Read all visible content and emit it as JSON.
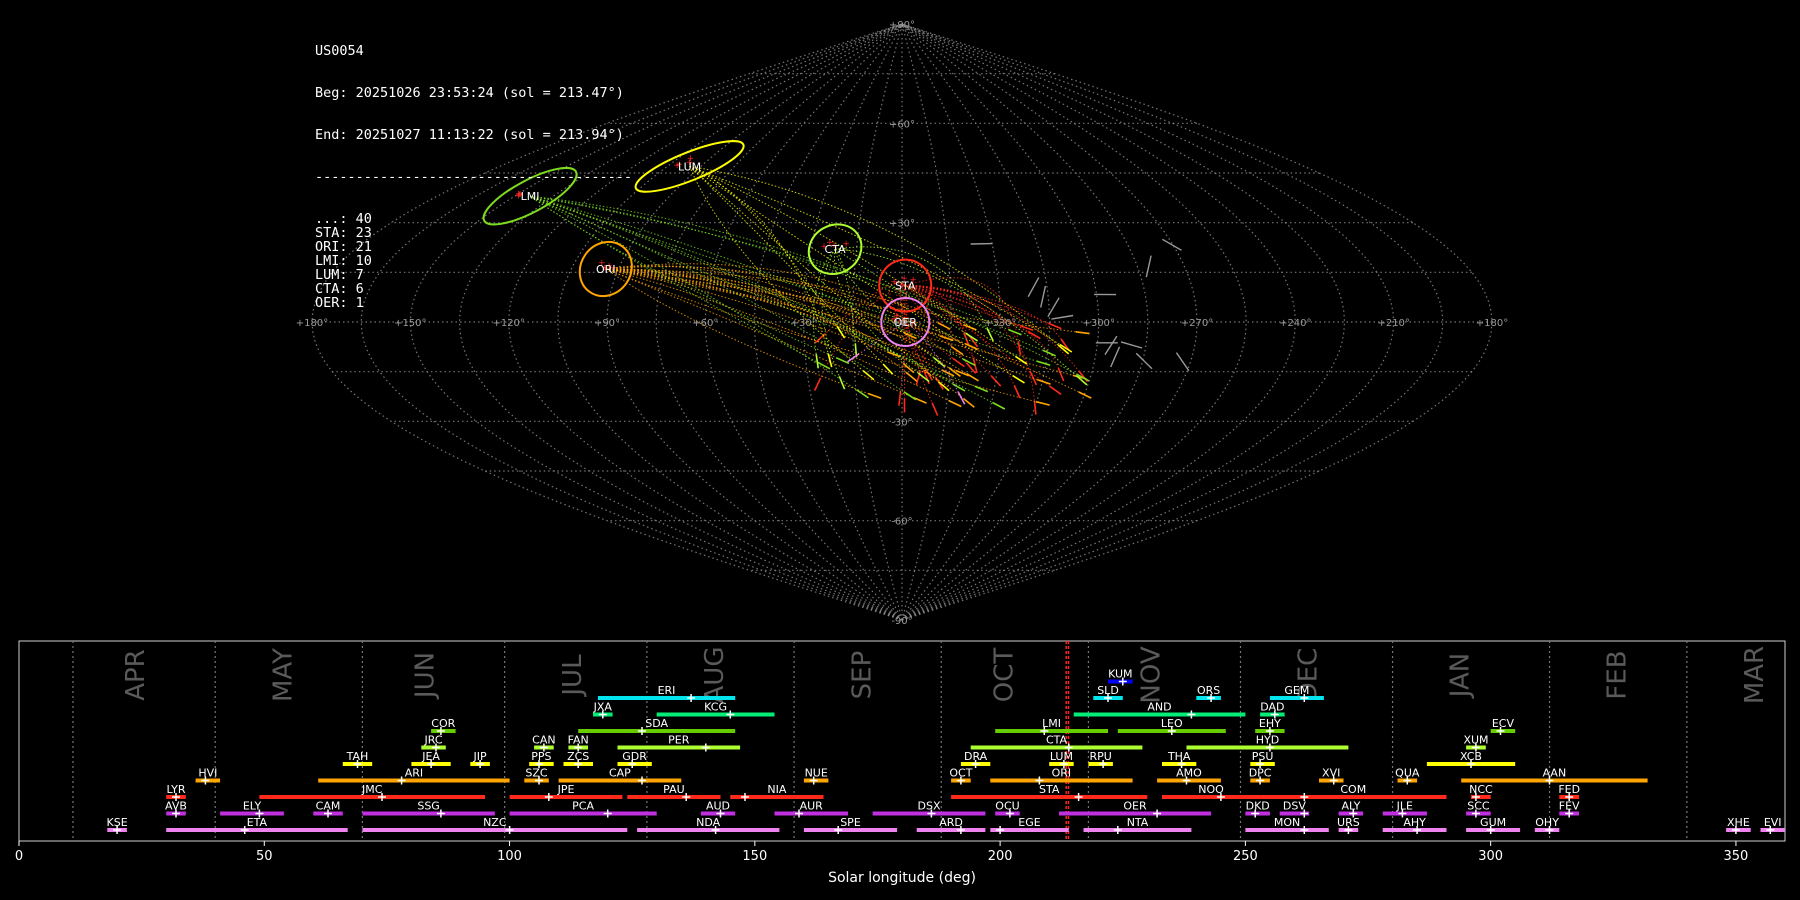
{
  "info": {
    "station": "US0054",
    "beg": "Beg: 20251026 23:53:24 (sol = 213.47°)",
    "end": "End: 20251027 11:13:22 (sol = 213.94°)",
    "separator": "---------------------------------------",
    "counts": [
      {
        "code": "...",
        "count": 40
      },
      {
        "code": "STA",
        "count": 23
      },
      {
        "code": "ORI",
        "count": 21
      },
      {
        "code": "LMI",
        "count": 10
      },
      {
        "code": "LUM",
        "count": 7
      },
      {
        "code": "CTA",
        "count": 6
      },
      {
        "code": "OER",
        "count": 1
      }
    ]
  },
  "chart_data": [
    {
      "type": "scatter",
      "projection": "sinusoidal sky map",
      "lon_tick_labels": [
        "+180°",
        "+150°",
        "+120°",
        "+90°",
        "+60°",
        "+30°",
        "+0°",
        "+330°",
        "+300°",
        "+270°",
        "+240°",
        "+210°",
        "+180°"
      ],
      "lat_tick_labels": [
        "+90°",
        "+60°",
        "+30°",
        "-30°",
        "-60°",
        "-90°"
      ],
      "colors": {
        "sporadic": "#ffffff",
        "STA": "#ff2a1a",
        "ORI": "#ffa500",
        "LMI": "#7ddc1f",
        "LUM": "#ffff00",
        "CTA": "#adff2f",
        "OER": "#ee82ee",
        "grid": "#8a8a8a"
      },
      "radiants": [
        {
          "code": "LUM",
          "lon": 95,
          "lat": 47,
          "color": "#ffff00"
        },
        {
          "code": "LMI",
          "lon": 144,
          "lat": 38,
          "color": "#7ddc1f"
        },
        {
          "code": "CTA",
          "lon": 22,
          "lat": 22,
          "color": "#adff2f"
        },
        {
          "code": "ORI",
          "lon": 94,
          "lat": 16,
          "color": "#ffa500"
        },
        {
          "code": "STA",
          "lon": -1,
          "lat": 11,
          "color": "#ff2a1a"
        },
        {
          "code": "OER",
          "lon": -1,
          "lat": 0,
          "color": "#ee82ee"
        }
      ]
    },
    {
      "type": "timeline",
      "xlabel": "Solar longitude (deg)",
      "xlim": [
        0,
        360
      ],
      "xticks": [
        0,
        50,
        100,
        150,
        200,
        250,
        300,
        350
      ],
      "current_sol": [
        213.47,
        213.94
      ],
      "months": [
        {
          "label": "APR",
          "pos": 24,
          "line": 11
        },
        {
          "label": "MAY",
          "pos": 54,
          "line": 40
        },
        {
          "label": "JUN",
          "pos": 83,
          "line": 70
        },
        {
          "label": "JUL",
          "pos": 113,
          "line": 99
        },
        {
          "label": "AUG",
          "pos": 142,
          "line": 128
        },
        {
          "label": "SEP",
          "pos": 172,
          "line": 158
        },
        {
          "label": "OCT",
          "pos": 201,
          "line": 188
        },
        {
          "label": "NOV",
          "pos": 231,
          "line": 218
        },
        {
          "label": "DEC",
          "pos": 263,
          "line": 249
        },
        {
          "label": "JAN",
          "pos": 294,
          "line": 280
        },
        {
          "label": "FEB",
          "pos": 326,
          "line": 312
        },
        {
          "label": "MAR",
          "pos": 354,
          "line": 340
        }
      ],
      "showers": [
        {
          "code": "KUM",
          "start": 222,
          "end": 227,
          "peak": 225,
          "row": 10,
          "color": "#0000ff"
        },
        {
          "code": "ERI",
          "start": 118,
          "end": 146,
          "peak": 137,
          "row": 9,
          "color": "#00e5ee"
        },
        {
          "code": "SLD",
          "start": 219,
          "end": 225,
          "peak": 222,
          "row": 9,
          "color": "#00e5ee"
        },
        {
          "code": "ORS",
          "start": 240,
          "end": 245,
          "peak": 243,
          "row": 9,
          "color": "#00e5ee"
        },
        {
          "code": "GEM",
          "start": 255,
          "end": 266,
          "peak": 262,
          "row": 9,
          "color": "#00e5ee"
        },
        {
          "code": "JXA",
          "start": 117,
          "end": 121,
          "peak": 119,
          "row": 8,
          "color": "#00ee76"
        },
        {
          "code": "KCG",
          "start": 130,
          "end": 154,
          "peak": 145,
          "row": 8,
          "color": "#00ee76"
        },
        {
          "code": "AND",
          "start": 215,
          "end": 250,
          "peak": 239,
          "row": 8,
          "color": "#00ee76"
        },
        {
          "code": "DAD",
          "start": 253,
          "end": 258,
          "peak": 256,
          "row": 8,
          "color": "#00ee76"
        },
        {
          "code": "COR",
          "start": 84,
          "end": 89,
          "peak": 86,
          "row": 7,
          "color": "#66cd00"
        },
        {
          "code": "SDA",
          "start": 114,
          "end": 146,
          "peak": 127,
          "row": 7,
          "color": "#66cd00"
        },
        {
          "code": "LMI",
          "start": 199,
          "end": 222,
          "peak": 209,
          "row": 7,
          "color": "#66cd00"
        },
        {
          "code": "LEO",
          "start": 224,
          "end": 246,
          "peak": 235,
          "row": 7,
          "color": "#66cd00"
        },
        {
          "code": "EHY",
          "start": 252,
          "end": 258,
          "peak": 255,
          "row": 7,
          "color": "#66cd00"
        },
        {
          "code": "ECV",
          "start": 300,
          "end": 305,
          "peak": 302,
          "row": 7,
          "color": "#66cd00"
        },
        {
          "code": "JRC",
          "start": 82,
          "end": 87,
          "peak": 85,
          "row": 6,
          "color": "#adff2f"
        },
        {
          "code": "CAN",
          "start": 105,
          "end": 109,
          "peak": 107,
          "row": 6,
          "color": "#adff2f"
        },
        {
          "code": "FAN",
          "start": 112,
          "end": 116,
          "peak": 114,
          "row": 6,
          "color": "#adff2f"
        },
        {
          "code": "PER",
          "start": 122,
          "end": 147,
          "peak": 140,
          "row": 6,
          "color": "#adff2f"
        },
        {
          "code": "CTA",
          "start": 194,
          "end": 229,
          "peak": 214,
          "row": 6,
          "color": "#adff2f"
        },
        {
          "code": "HYD",
          "start": 238,
          "end": 271,
          "peak": 255,
          "row": 6,
          "color": "#adff2f"
        },
        {
          "code": "XUM",
          "start": 295,
          "end": 299,
          "peak": 297,
          "row": 6,
          "color": "#adff2f"
        },
        {
          "code": "TAH",
          "start": 66,
          "end": 72,
          "peak": 69,
          "row": 5,
          "color": "#ffff00"
        },
        {
          "code": "JEA",
          "start": 80,
          "end": 88,
          "peak": 84,
          "row": 5,
          "color": "#ffff00"
        },
        {
          "code": "JIP",
          "start": 92,
          "end": 96,
          "peak": 94,
          "row": 5,
          "color": "#ffff00"
        },
        {
          "code": "PPS",
          "start": 104,
          "end": 109,
          "peak": 106,
          "row": 5,
          "color": "#ffff00"
        },
        {
          "code": "ZCS",
          "start": 111,
          "end": 117,
          "peak": 114,
          "row": 5,
          "color": "#ffff00"
        },
        {
          "code": "GDR",
          "start": 122,
          "end": 129,
          "peak": 125,
          "row": 5,
          "color": "#ffff00"
        },
        {
          "code": "DRA",
          "start": 192,
          "end": 198,
          "peak": 195,
          "row": 5,
          "color": "#ffff00"
        },
        {
          "code": "LUM",
          "start": 210,
          "end": 215,
          "peak": 213,
          "row": 5,
          "color": "#ffff00"
        },
        {
          "code": "RPU",
          "start": 218,
          "end": 223,
          "peak": 221,
          "row": 5,
          "color": "#ffff00"
        },
        {
          "code": "THA",
          "start": 233,
          "end": 240,
          "peak": 237,
          "row": 5,
          "color": "#ffff00"
        },
        {
          "code": "PSU",
          "start": 251,
          "end": 256,
          "peak": 253,
          "row": 5,
          "color": "#ffff00"
        },
        {
          "code": "XCB",
          "start": 287,
          "end": 305,
          "peak": 296,
          "row": 5,
          "color": "#ffff00"
        },
        {
          "code": "HVI",
          "start": 36,
          "end": 41,
          "peak": 38,
          "row": 4,
          "color": "#ffa500"
        },
        {
          "code": "ARI",
          "start": 61,
          "end": 100,
          "peak": 78,
          "row": 4,
          "color": "#ffa500"
        },
        {
          "code": "SZC",
          "start": 103,
          "end": 108,
          "peak": 106,
          "row": 4,
          "color": "#ffa500"
        },
        {
          "code": "CAP",
          "start": 110,
          "end": 135,
          "peak": 127,
          "row": 4,
          "color": "#ffa500"
        },
        {
          "code": "NUE",
          "start": 160,
          "end": 165,
          "peak": 162,
          "row": 4,
          "color": "#ffa500"
        },
        {
          "code": "OCT",
          "start": 190,
          "end": 194,
          "peak": 192,
          "row": 4,
          "color": "#ffa500"
        },
        {
          "code": "ORI",
          "start": 198,
          "end": 227,
          "peak": 208,
          "row": 4,
          "color": "#ffa500"
        },
        {
          "code": "AMO",
          "start": 232,
          "end": 245,
          "peak": 238,
          "row": 4,
          "color": "#ffa500"
        },
        {
          "code": "DPC",
          "start": 251,
          "end": 255,
          "peak": 253,
          "row": 4,
          "color": "#ffa500"
        },
        {
          "code": "XVI",
          "start": 265,
          "end": 270,
          "peak": 268,
          "row": 4,
          "color": "#ffa500"
        },
        {
          "code": "QUA",
          "start": 281,
          "end": 285,
          "peak": 283,
          "row": 4,
          "color": "#ffa500"
        },
        {
          "code": "AAN",
          "start": 294,
          "end": 332,
          "peak": 312,
          "row": 4,
          "color": "#ffa500"
        },
        {
          "code": "LYR",
          "start": 30,
          "end": 34,
          "peak": 32,
          "row": 3,
          "color": "#ff2a1a"
        },
        {
          "code": "JMC",
          "start": 49,
          "end": 95,
          "peak": 74,
          "row": 3,
          "color": "#ff2a1a"
        },
        {
          "code": "JPE",
          "start": 100,
          "end": 123,
          "peak": 108,
          "row": 3,
          "color": "#ff2a1a"
        },
        {
          "code": "PAU",
          "start": 124,
          "end": 143,
          "peak": 136,
          "row": 3,
          "color": "#ff2a1a"
        },
        {
          "code": "NIA",
          "start": 145,
          "end": 164,
          "peak": 148,
          "row": 3,
          "color": "#ff2a1a"
        },
        {
          "code": "STA",
          "start": 190,
          "end": 230,
          "peak": 216,
          "row": 3,
          "color": "#ff2a1a"
        },
        {
          "code": "NOO",
          "start": 233,
          "end": 253,
          "peak": 245,
          "row": 3,
          "color": "#ff2a1a"
        },
        {
          "code": "COM",
          "start": 253,
          "end": 291,
          "peak": 262,
          "row": 3,
          "color": "#ff2a1a"
        },
        {
          "code": "NCC",
          "start": 296,
          "end": 300,
          "peak": 297,
          "row": 3,
          "color": "#ff2a1a"
        },
        {
          "code": "FED",
          "start": 314,
          "end": 318,
          "peak": 316,
          "row": 3,
          "color": "#ff2a1a"
        },
        {
          "code": "AVB",
          "start": 30,
          "end": 34,
          "peak": 32,
          "row": 2,
          "color": "#c030e0"
        },
        {
          "code": "ELY",
          "start": 41,
          "end": 54,
          "peak": 49,
          "row": 2,
          "color": "#c030e0"
        },
        {
          "code": "CAM",
          "start": 60,
          "end": 66,
          "peak": 63,
          "row": 2,
          "color": "#c030e0"
        },
        {
          "code": "SSG",
          "start": 70,
          "end": 97,
          "peak": 86,
          "row": 2,
          "color": "#c030e0"
        },
        {
          "code": "PCA",
          "start": 100,
          "end": 130,
          "peak": 120,
          "row": 2,
          "color": "#c030e0"
        },
        {
          "code": "AUD",
          "start": 139,
          "end": 146,
          "peak": 143,
          "row": 2,
          "color": "#c030e0"
        },
        {
          "code": "AUR",
          "start": 154,
          "end": 169,
          "peak": 159,
          "row": 2,
          "color": "#c030e0"
        },
        {
          "code": "DSX",
          "start": 174,
          "end": 197,
          "peak": 186,
          "row": 2,
          "color": "#c030e0"
        },
        {
          "code": "OCU",
          "start": 199,
          "end": 204,
          "peak": 202,
          "row": 2,
          "color": "#c030e0"
        },
        {
          "code": "OER",
          "start": 212,
          "end": 243,
          "peak": 232,
          "row": 2,
          "color": "#c030e0"
        },
        {
          "code": "DKD",
          "start": 250,
          "end": 255,
          "peak": 252,
          "row": 2,
          "color": "#c030e0"
        },
        {
          "code": "DSV",
          "start": 257,
          "end": 263,
          "peak": 262,
          "row": 2,
          "color": "#c030e0"
        },
        {
          "code": "ALY",
          "start": 269,
          "end": 274,
          "peak": 272,
          "row": 2,
          "color": "#c030e0"
        },
        {
          "code": "JLE",
          "start": 278,
          "end": 287,
          "peak": 282,
          "row": 2,
          "color": "#c030e0"
        },
        {
          "code": "SCC",
          "start": 295,
          "end": 300,
          "peak": 297,
          "row": 2,
          "color": "#c030e0"
        },
        {
          "code": "FEV",
          "start": 314,
          "end": 318,
          "peak": 316,
          "row": 2,
          "color": "#c030e0"
        },
        {
          "code": "KSE",
          "start": 18,
          "end": 22,
          "peak": 20,
          "row": 1,
          "color": "#ee82ee"
        },
        {
          "code": "ETA",
          "start": 30,
          "end": 67,
          "peak": 46,
          "row": 1,
          "color": "#ee82ee"
        },
        {
          "code": "NZC",
          "start": 70,
          "end": 124,
          "peak": 100,
          "row": 1,
          "color": "#ee82ee"
        },
        {
          "code": "NDA",
          "start": 126,
          "end": 155,
          "peak": 142,
          "row": 1,
          "color": "#ee82ee"
        },
        {
          "code": "SPE",
          "start": 160,
          "end": 179,
          "peak": 167,
          "row": 1,
          "color": "#ee82ee"
        },
        {
          "code": "ARD",
          "start": 183,
          "end": 197,
          "peak": 192,
          "row": 1,
          "color": "#ee82ee"
        },
        {
          "code": "EGE",
          "start": 198,
          "end": 214,
          "peak": 200,
          "row": 1,
          "color": "#ee82ee"
        },
        {
          "code": "NTA",
          "start": 217,
          "end": 239,
          "peak": 224,
          "row": 1,
          "color": "#ee82ee"
        },
        {
          "code": "MON",
          "start": 250,
          "end": 267,
          "peak": 262,
          "row": 1,
          "color": "#ee82ee"
        },
        {
          "code": "URS",
          "start": 269,
          "end": 273,
          "peak": 271,
          "row": 1,
          "color": "#ee82ee"
        },
        {
          "code": "AHY",
          "start": 278,
          "end": 291,
          "peak": 285,
          "row": 1,
          "color": "#ee82ee"
        },
        {
          "code": "GUM",
          "start": 295,
          "end": 306,
          "peak": 300,
          "row": 1,
          "color": "#ee82ee"
        },
        {
          "code": "OHY",
          "start": 309,
          "end": 314,
          "peak": 312,
          "row": 1,
          "color": "#ee82ee"
        },
        {
          "code": "XHE",
          "start": 348,
          "end": 353,
          "peak": 350,
          "row": 1,
          "color": "#ee82ee"
        },
        {
          "code": "EVI",
          "start": 355,
          "end": 360,
          "peak": 357,
          "row": 1,
          "color": "#ee82ee"
        }
      ]
    }
  ]
}
